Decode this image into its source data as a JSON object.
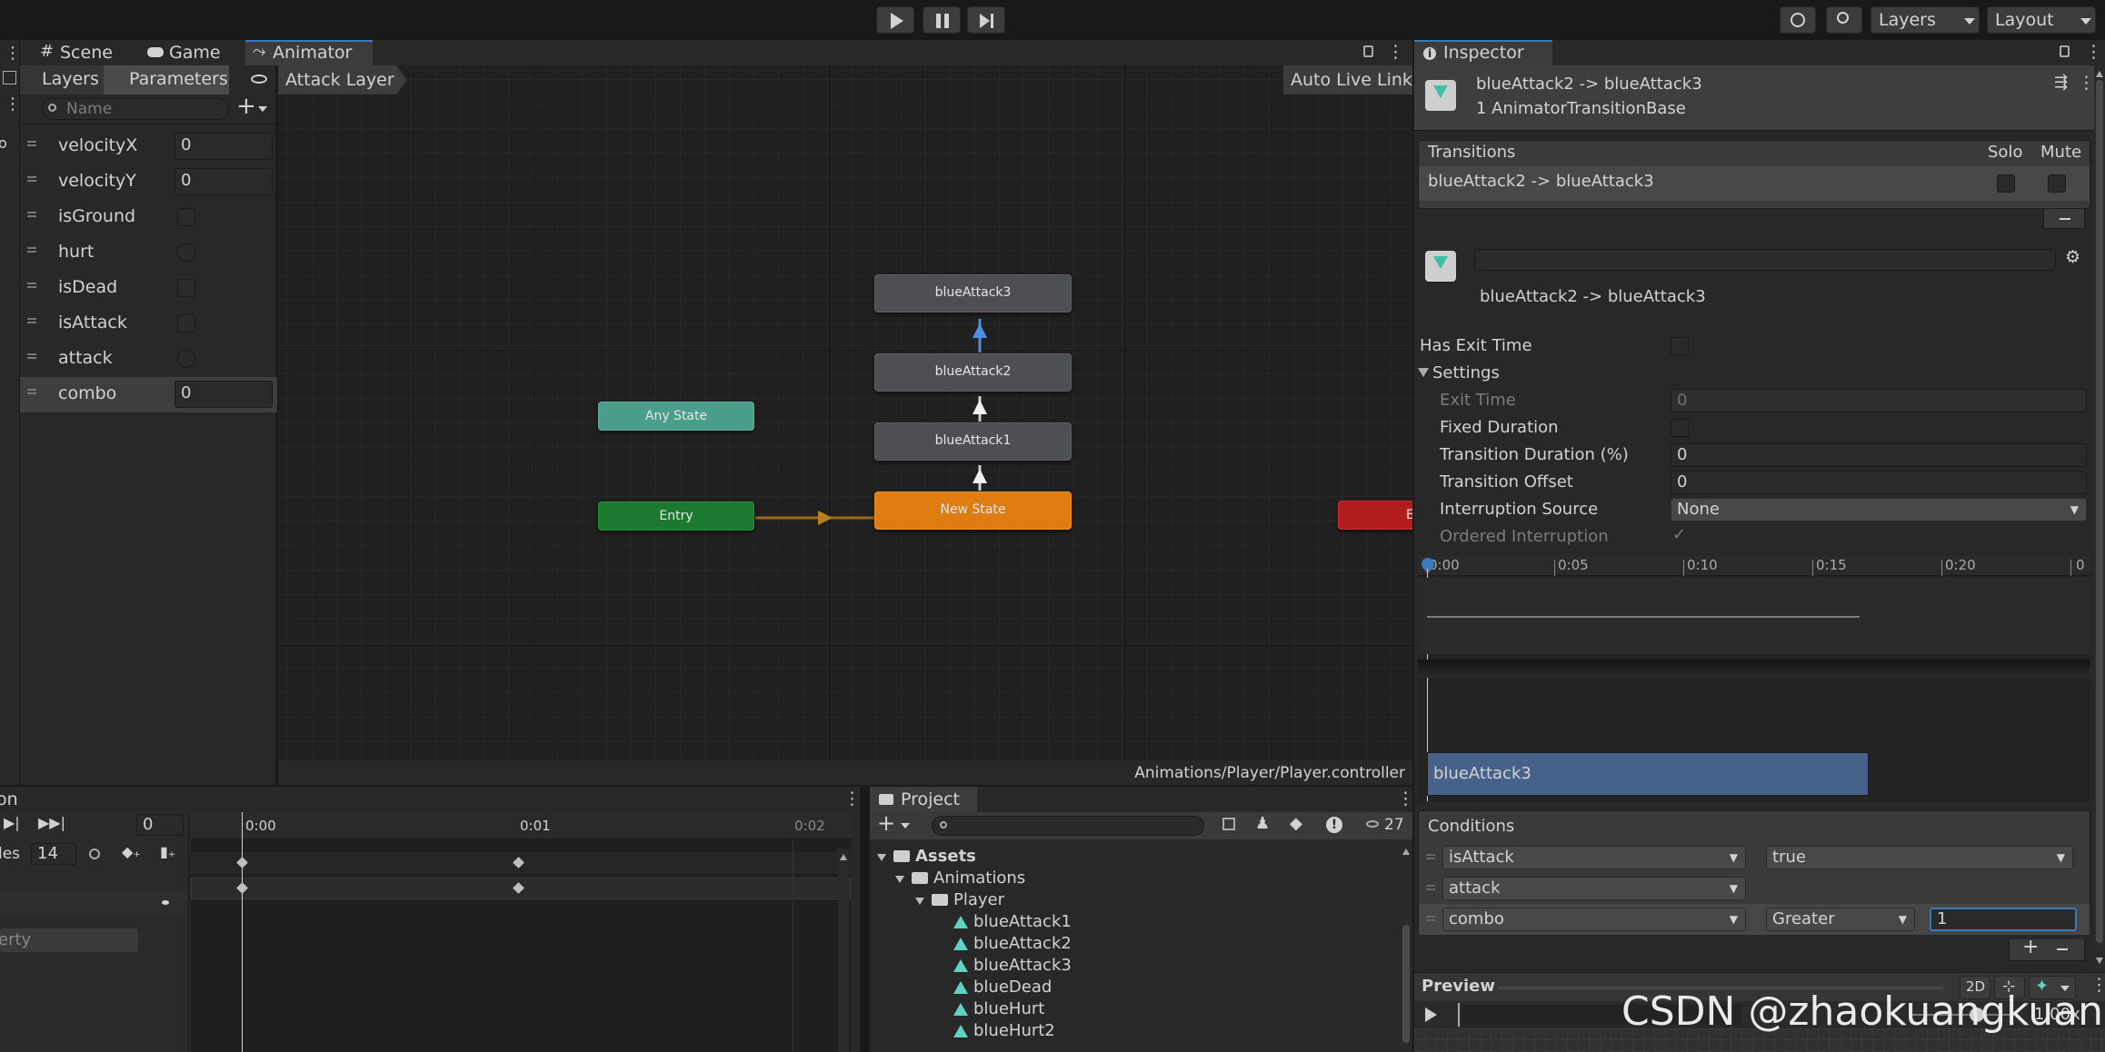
{
  "toolbar": {
    "play_icon": "play-icon",
    "pause_icon": "pause-icon",
    "step_icon": "step-icon",
    "layers_label": "Layers",
    "layout_label": "Layout"
  },
  "animator_window": {
    "tabs": [
      {
        "label": "Scene",
        "icon": "hash-icon"
      },
      {
        "label": "Game",
        "icon": "gamepad-icon"
      },
      {
        "label": "Animator",
        "icon": "animator-icon"
      }
    ],
    "left_tabs": [
      "Layers",
      "Parameters"
    ],
    "search_placeholder": "Name",
    "breadcrumb": "Attack Layer",
    "auto_live_link": "Auto Live Link",
    "footer_path": "Animations/Player/Player.controller",
    "parameters": [
      {
        "name": "velocityX",
        "type": "float",
        "value": "0"
      },
      {
        "name": "velocityY",
        "type": "float",
        "value": "0"
      },
      {
        "name": "isGround",
        "type": "bool",
        "value": ""
      },
      {
        "name": "hurt",
        "type": "trigger",
        "value": ""
      },
      {
        "name": "isDead",
        "type": "bool",
        "value": ""
      },
      {
        "name": "isAttack",
        "type": "bool",
        "value": ""
      },
      {
        "name": "attack",
        "type": "trigger",
        "value": ""
      },
      {
        "name": "combo",
        "type": "int",
        "value": "0"
      }
    ],
    "nodes": {
      "blueAttack3": "blueAttack3",
      "blueAttack2": "blueAttack2",
      "blueAttack1": "blueAttack1",
      "any_state": "Any State",
      "entry": "Entry",
      "new_state": "New State",
      "exit": "E"
    },
    "colors": {
      "state": "#4e4f52",
      "any_state": "#4a9e8a",
      "entry": "#1b7a2f",
      "default_state": "#e07d12",
      "exit": "#b31c1c",
      "selected_arrow": "#4f8fdf"
    }
  },
  "animation_window": {
    "title": "on",
    "frame_value": "0",
    "samples_label": "les",
    "samples_value": "14",
    "ruler": [
      "0:00",
      "0:01",
      "0:02"
    ],
    "property_label": "erty"
  },
  "project_window": {
    "tab": "Project",
    "count": "27",
    "tree": [
      {
        "label": "Assets",
        "type": "folder",
        "level": 0,
        "bold": true
      },
      {
        "label": "Animations",
        "type": "folder",
        "level": 1
      },
      {
        "label": "Player",
        "type": "folder",
        "level": 2
      },
      {
        "label": "blueAttack1",
        "type": "anim",
        "level": 3
      },
      {
        "label": "blueAttack2",
        "type": "anim",
        "level": 3
      },
      {
        "label": "blueAttack3",
        "type": "anim",
        "level": 3
      },
      {
        "label": "blueDead",
        "type": "anim",
        "level": 3
      },
      {
        "label": "blueHurt",
        "type": "anim",
        "level": 3
      },
      {
        "label": "blueHurt2",
        "type": "anim",
        "level": 3
      }
    ]
  },
  "inspector": {
    "tab": "Inspector",
    "header_title": "blueAttack2 -> blueAttack3",
    "header_sub": "1 AnimatorTransitionBase",
    "transitions_label": "Transitions",
    "solo_label": "Solo",
    "mute_label": "Mute",
    "transition_item": "blueAttack2 -> blueAttack3",
    "name_field": "",
    "sub_title": "blueAttack2 -> blueAttack3",
    "has_exit_time": "Has Exit Time",
    "settings": "Settings",
    "fields": {
      "exit_time": {
        "label": "Exit Time",
        "value": "0"
      },
      "fixed_duration": {
        "label": "Fixed Duration"
      },
      "transition_duration": {
        "label": "Transition Duration (%)",
        "value": "0"
      },
      "transition_offset": {
        "label": "Transition Offset",
        "value": "0"
      },
      "interruption_source": {
        "label": "Interruption Source",
        "value": "None"
      },
      "ordered_interruption": {
        "label": "Ordered Interruption",
        "value": "✓"
      }
    },
    "timeline": {
      "ticks": [
        "0:00",
        "0:05",
        "0:10",
        "0:15",
        "0:20",
        "0"
      ],
      "clip_label": "blueAttack3"
    },
    "conditions_label": "Conditions",
    "conditions": [
      {
        "param": "isAttack",
        "mode": "true",
        "value": null
      },
      {
        "param": "attack",
        "mode": null,
        "value": null
      },
      {
        "param": "combo",
        "mode": "Greater",
        "value": "1"
      }
    ],
    "preview_label": "Preview",
    "preview_2d": "2D",
    "preview_speed": "1.00x",
    "watermark": "CSDN @zhaokuangkuang_"
  }
}
